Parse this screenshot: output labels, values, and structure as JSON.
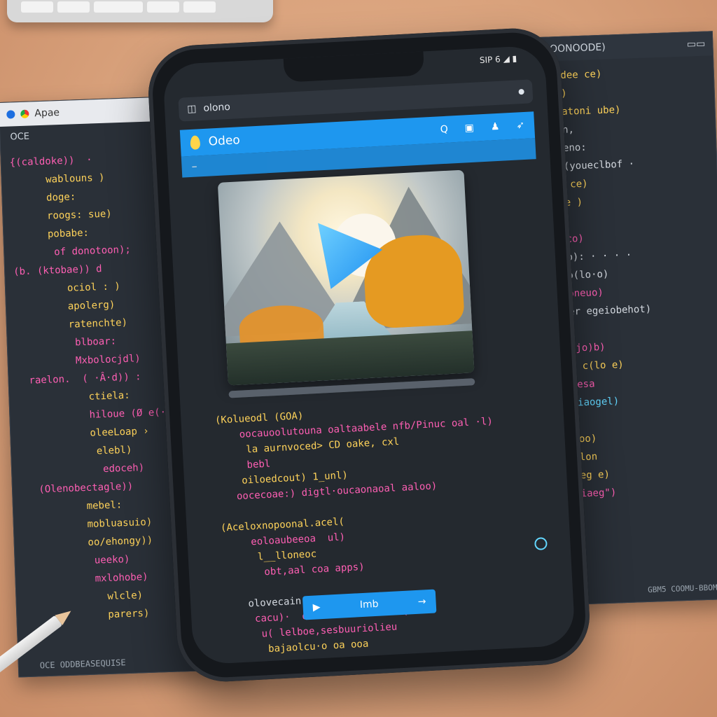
{
  "left_window": {
    "title": "Apae",
    "tab": "OCE",
    "footer": "OCE ODDBEASEQUISE",
    "lines": [
      {
        "t": "{(caldoke))  ·",
        "c": "c-pink"
      },
      {
        "t": "      wablouns )",
        "c": "c-yel"
      },
      {
        "t": "      doge:",
        "c": "c-yel"
      },
      {
        "t": "      roogs: sue)",
        "c": "c-yel"
      },
      {
        "t": "      pobabe:",
        "c": "c-yel"
      },
      {
        "t": "       of donotoon);",
        "c": "c-pink"
      },
      {
        "t": "(b. (ktobae)) d",
        "c": "c-pink"
      },
      {
        "t": "         ociol : )",
        "c": "c-yel"
      },
      {
        "t": "         apolerg)",
        "c": "c-yel"
      },
      {
        "t": "         ratenchte)",
        "c": "c-yel"
      },
      {
        "t": "          blboar:",
        "c": "c-pink"
      },
      {
        "t": "          Mxbolocjdl)",
        "c": "c-pink"
      },
      {
        "t": "  raelon.  ( ·Â·d)) :",
        "c": "c-pink"
      },
      {
        "t": "            ctiela:",
        "c": "c-yel"
      },
      {
        "t": "            hiloue (Ø e(·:",
        "c": "c-pink"
      },
      {
        "t": "            oleeLoap ›",
        "c": "c-yel"
      },
      {
        "t": "             elebl)",
        "c": "c-yel"
      },
      {
        "t": "              edoceh)",
        "c": "c-pink"
      },
      {
        "t": "   (Olenobectagle))",
        "c": "c-pink"
      },
      {
        "t": "           mebel:",
        "c": "c-yel"
      },
      {
        "t": "           mobluasuio)",
        "c": "c-yel"
      },
      {
        "t": "           oo/ehongy))",
        "c": "c-yel"
      },
      {
        "t": "            ueeko)",
        "c": "c-pink"
      },
      {
        "t": "            mxlohobe)",
        "c": "c-pink"
      },
      {
        "t": "              wlcle)",
        "c": "c-yel"
      },
      {
        "t": "              parers)",
        "c": "c-yel"
      }
    ]
  },
  "right_window": {
    "title": "(RITROONOODE)",
    "footer": "GBM5 COOMU-BBOM",
    "lines": [
      {
        "t": "      (elrozadee ce)",
        "c": "c-yel"
      },
      {
        "t": "       Dooory)",
        "c": "c-yel"
      },
      {
        "t": "       eleobcatoni ube)",
        "c": "c-yel"
      },
      {
        "t": "       dlaeann,",
        "c": "c-wht"
      },
      {
        "t": "  wideceint oeno:",
        "c": "c-wht"
      },
      {
        "t": "  ((( · awtit(youeclbof ·",
        "c": "c-wht"
      },
      {
        "t": "       ocalov ce)",
        "c": "c-yel"
      },
      {
        "t": "       olocabe )",
        "c": "c-yel"
      },
      {
        "t": "       otoc",
        "c": "c-yel"
      },
      {
        "t": "       odeceuco)",
        "c": "c-pink"
      },
      {
        "t": "  (iz  (euooab): · · · ·",
        "c": "c-wht"
      },
      {
        "t": "       olorl o(lo·o)",
        "c": "c-wht"
      },
      {
        "t": "       elociloneuo)",
        "c": "c-pink"
      },
      {
        "t": " ((. elli arler egeiobehot)",
        "c": "c-wht"
      },
      {
        "t": "        eoape)",
        "c": "c-yel"
      },
      {
        "t": "        oxcerojo)b)",
        "c": "c-pink"
      },
      {
        "t": "        oloioL c(lo e)",
        "c": "c-yel"
      },
      {
        "t": "        ooecauesa",
        "c": "c-pink"
      },
      {
        "t": "     (lolaeobriaogel)",
        "c": "c-cyan"
      },
      {
        "t": "       (beoal",
        "c": "c-yel"
      },
      {
        "t": "        ojeol oo)",
        "c": "c-yel"
      },
      {
        "t": "         eoclolon",
        "c": "c-yel"
      },
      {
        "t": "         foceleg e)",
        "c": "c-yel"
      },
      {
        "t": "       edbogeliaeg\")",
        "c": "c-pink"
      }
    ]
  },
  "phone": {
    "status": "SIP 6 ◢ ▮",
    "url": "olono",
    "app_name": "Odeo",
    "subbar": "–",
    "progress": 1.0,
    "button_label": "Imb",
    "code_lines": [
      {
        "t": " (Kolueodl (GOA)",
        "c": "c-yel"
      },
      {
        "t": "     oocauoolutouna oaltaabele nfb/Pinuc oal ·l)",
        "c": "c-pink"
      },
      {
        "t": "      la aurnvoced> CD oake, cxl",
        "c": "c-yel"
      },
      {
        "t": "      bebl",
        "c": "c-pink"
      },
      {
        "t": "     oiloedcout) 1_unl)",
        "c": "c-yel"
      },
      {
        "t": "    oocecoae:) digtl·oucaonaoal aaloo)",
        "c": "c-pink"
      },
      {
        "t": "",
        "c": "c-wht"
      },
      {
        "t": " (Aceloxnopoonal.acel(",
        "c": "c-yel"
      },
      {
        "t": "      eoloaubeeoa  ul)",
        "c": "c-pink"
      },
      {
        "t": "       l__lloneoc",
        "c": "c-yel"
      },
      {
        "t": "        obt,aal coa apps)",
        "c": "c-pink"
      },
      {
        "t": "",
        "c": "c-wht"
      },
      {
        "t": "     olovecain- oaoolo:(otal ·a)",
        "c": "c-wht"
      },
      {
        "t": "      cacu)·  ocoelow ahlinaon.(ooo",
        "c": "c-pink"
      },
      {
        "t": "       u( lelboe,sesbuuriolieu",
        "c": "c-pink"
      },
      {
        "t": "        bajaolcu·o oa ooa",
        "c": "c-yel"
      }
    ]
  }
}
